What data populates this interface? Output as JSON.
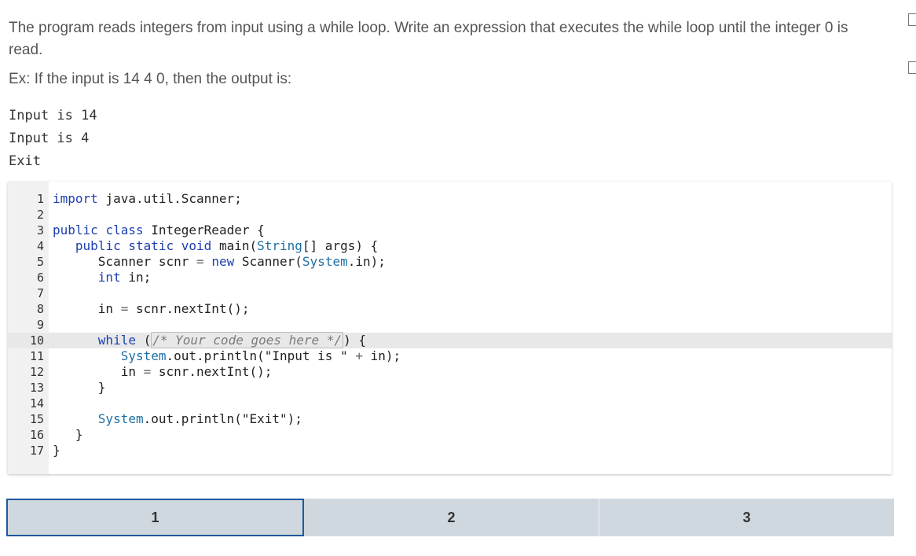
{
  "prompt": {
    "text": "The program reads integers from input using a while loop. Write an expression that executes the while loop until the integer 0 is read."
  },
  "example": {
    "text": "Ex: If the input is 14 4 0, then the output is:",
    "output_lines": [
      "Input is 14",
      "Input is 4",
      "Exit"
    ]
  },
  "editor": {
    "active_line": 10,
    "lines": [
      {
        "n": "1",
        "code": "import java.util.Scanner;"
      },
      {
        "n": "2",
        "code": ""
      },
      {
        "n": "3",
        "code": "public class IntegerReader {"
      },
      {
        "n": "4",
        "code": "   public static void main(String[] args) {"
      },
      {
        "n": "5",
        "code": "      Scanner scnr = new Scanner(System.in);"
      },
      {
        "n": "6",
        "code": "      int in;"
      },
      {
        "n": "7",
        "code": ""
      },
      {
        "n": "8",
        "code": "      in = scnr.nextInt();"
      },
      {
        "n": "9",
        "code": ""
      },
      {
        "n": "10",
        "code": "      while (/* Your code goes here */) {"
      },
      {
        "n": "11",
        "code": "         System.out.println(\"Input is \" + in);"
      },
      {
        "n": "12",
        "code": "         in = scnr.nextInt();"
      },
      {
        "n": "13",
        "code": "      }"
      },
      {
        "n": "14",
        "code": ""
      },
      {
        "n": "15",
        "code": "      System.out.println(\"Exit\");"
      },
      {
        "n": "16",
        "code": "   }"
      },
      {
        "n": "17",
        "code": "}"
      }
    ],
    "placeholder_comment": "/* Your code goes here */"
  },
  "tabs": [
    {
      "label": "1",
      "selected": true
    },
    {
      "label": "2",
      "selected": false
    },
    {
      "label": "3",
      "selected": false
    }
  ],
  "colors": {
    "tab_background": "#d0d8df",
    "tab_selected_border": "#1d5a9a",
    "keyword": "#1d3fb0",
    "gutter": "#f1f1f1"
  }
}
